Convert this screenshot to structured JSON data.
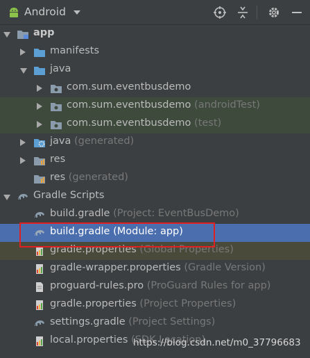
{
  "toolbar": {
    "title": "Android",
    "icons": [
      "android-icon",
      "crosshair-icon",
      "collapse-icon",
      "gear-icon",
      "hide-icon"
    ]
  },
  "tree": [
    {
      "label": "app",
      "hint": "",
      "icon": "module-folder-icon",
      "expanded": true
    },
    {
      "label": "manifests",
      "hint": "",
      "icon": "folder-icon",
      "expanded": false
    },
    {
      "label": "java",
      "hint": "",
      "icon": "folder-icon",
      "expanded": true
    },
    {
      "label": "com.sum.eventbusdemo",
      "hint": "",
      "icon": "package-icon",
      "expanded": false
    },
    {
      "label": "com.sum.eventbusdemo",
      "hint": "(androidTest)",
      "icon": "package-icon",
      "expanded": false
    },
    {
      "label": "com.sum.eventbusdemo",
      "hint": "(test)",
      "icon": "package-icon",
      "expanded": false
    },
    {
      "label": "java",
      "hint": "(generated)",
      "icon": "generated-folder-icon",
      "expanded": false
    },
    {
      "label": "res",
      "hint": "",
      "icon": "res-folder-icon",
      "expanded": false
    },
    {
      "label": "res",
      "hint": "(generated)",
      "icon": "res-folder-icon",
      "expanded": null
    },
    {
      "label": "Gradle Scripts",
      "hint": "",
      "icon": "gradle-icon",
      "expanded": true
    },
    {
      "label": "build.gradle",
      "hint": "(Project: EventBusDemo)",
      "icon": "gradle-icon"
    },
    {
      "label": "build.gradle",
      "hint": "(Module: app)",
      "icon": "gradle-icon"
    },
    {
      "label": "gradle.properties",
      "hint": "(Global Properties)",
      "icon": "properties-icon"
    },
    {
      "label": "gradle-wrapper.properties",
      "hint": "(Gradle Version)",
      "icon": "properties-icon"
    },
    {
      "label": "proguard-rules.pro",
      "hint": "(ProGuard Rules for app)",
      "icon": "file-icon"
    },
    {
      "label": "gradle.properties",
      "hint": "(Project Properties)",
      "icon": "properties-icon"
    },
    {
      "label": "settings.gradle",
      "hint": "(Project Settings)",
      "icon": "gradle-icon"
    },
    {
      "label": "local.properties",
      "hint": "(SDK Location)",
      "icon": "properties-icon"
    }
  ],
  "selected_item": "build.gradle (Module: app)",
  "watermark": "https://blog.csdn.net/m0_37796683",
  "colors": {
    "background": "#3c3f41",
    "selection": "#4b6eaf",
    "test_highlight": "#3d4a3c",
    "annotation_box": "#e02020"
  }
}
